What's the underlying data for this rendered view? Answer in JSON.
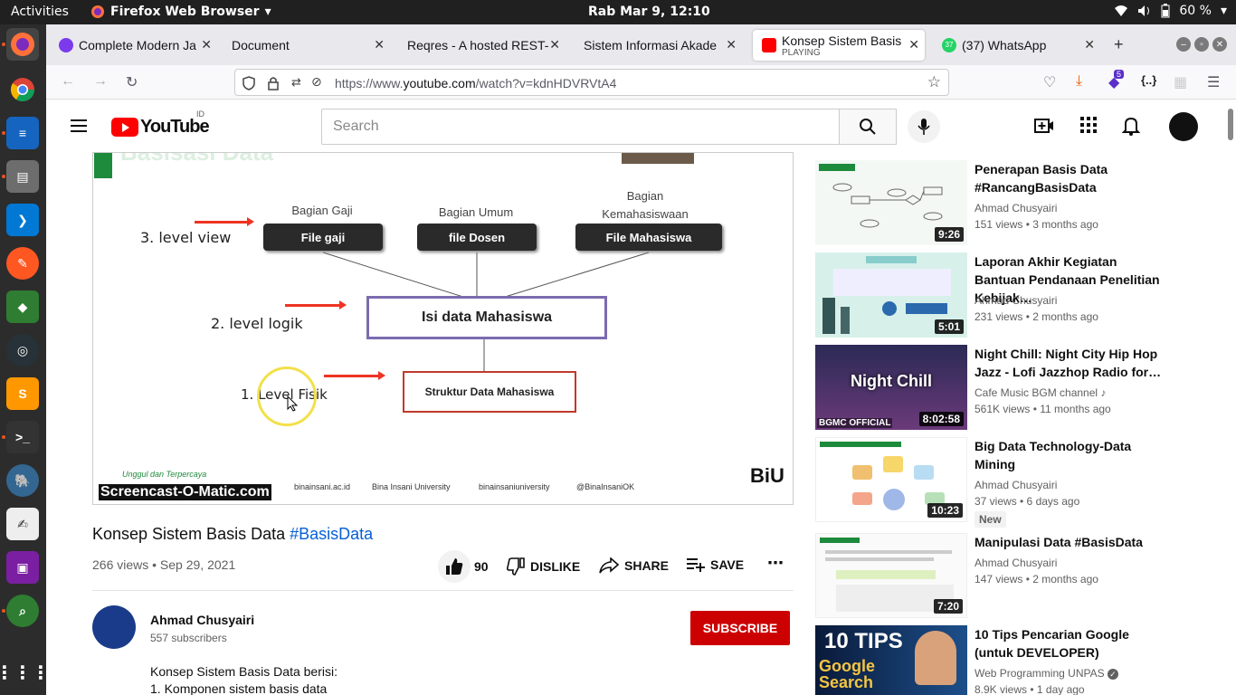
{
  "topbar": {
    "activities": "Activities",
    "app": "Firefox Web Browser",
    "clock": "Rab Mar  9, 12:10",
    "battery": "60 %"
  },
  "tabs": [
    {
      "title": "Complete Modern Ja",
      "color": "#7c3aed"
    },
    {
      "title": "Document",
      "color": ""
    },
    {
      "title": "Reqres - A hosted REST-",
      "color": ""
    },
    {
      "title": "Sistem Informasi Akade",
      "color": ""
    },
    {
      "title": "Konsep Sistem Basis",
      "sub": "PLAYING",
      "color": "#ff0000"
    },
    {
      "title": "(37) WhatsApp",
      "badge": "37",
      "color": "#25d366"
    }
  ],
  "nav": {
    "url_prefix": "https://www.",
    "url_domain": "youtube.com",
    "url_path": "/watch?v=kdnHDVRVtA4",
    "ext_badge": "5"
  },
  "youtube": {
    "logo_text": "YouTube",
    "country": "ID",
    "search_placeholder": "Search"
  },
  "slide": {
    "title": "Basisasi Data",
    "levels": [
      "3. level  view",
      "2. level  logik",
      "1. Level  Fisik"
    ],
    "captions": [
      "Bagian Gaji",
      "Bagian Umum",
      "Bagian\nKemahasiswaan"
    ],
    "files": [
      "File gaji",
      "file Dosen",
      "File Mahasiswa"
    ],
    "logic_box": "Isi data Mahasiswa",
    "phys_box": "Struktur Data Mahasiswa",
    "motto": "Unggul dan Terpercaya",
    "watermark": "Screencast-O-Matic.com",
    "footer": [
      "binainsani.ac.id",
      "Bina Insani University",
      "binainsaniuniversity",
      "@BinaInsaniOK"
    ],
    "brand": "BiU"
  },
  "video": {
    "title": "Konsep Sistem Basis Data ",
    "hashtag": "#BasisData",
    "meta": "266 views • Sep 29, 2021",
    "likes": "90",
    "dislike": "DISLIKE",
    "share": "SHARE",
    "save": "SAVE"
  },
  "channel": {
    "name": "Ahmad Chusyairi",
    "subs": "557 subscribers",
    "subscribe": "SUBSCRIBE",
    "desc1": "Konsep Sistem Basis Data berisi:",
    "desc2": "1. Komponen sistem basis data"
  },
  "recs": [
    {
      "title": "Penerapan Basis Data #RancangBasisData",
      "channel": "Ahmad Chusyairi",
      "meta": "151 views • 3 months ago",
      "dur": "9:26"
    },
    {
      "title": "Laporan Akhir Kegiatan Bantuan Pendanaan Penelitian Kebijak…",
      "channel": "Ahmad Chusyairi",
      "meta": "231 views • 2 months ago",
      "dur": "5:01"
    },
    {
      "title": "Night Chill: Night City Hip Hop Jazz - Lofi Jazzhop Radio for…",
      "channel": "Cafe Music BGM channel",
      "meta": "561K views • 11 months ago",
      "dur": "8:02:58",
      "thumb_text": "Night Chill",
      "thumb_brand": "BGMC OFFICIAL"
    },
    {
      "title": "Big Data Technology-Data Mining",
      "channel": "Ahmad Chusyairi",
      "meta": "37 views • 6 days ago",
      "dur": "10:23",
      "badge": "New"
    },
    {
      "title": "Manipulasi Data #BasisData",
      "channel": "Ahmad Chusyairi",
      "meta": "147 views • 2 months ago",
      "dur": "7:20"
    },
    {
      "title": "10 Tips Pencarian Google (untuk DEVELOPER)",
      "channel": "Web Programming UNPAS",
      "meta": "8.9K views • 1 day ago",
      "thumb_text": "10 TIPS",
      "thumb_sub": "Google Search"
    }
  ]
}
